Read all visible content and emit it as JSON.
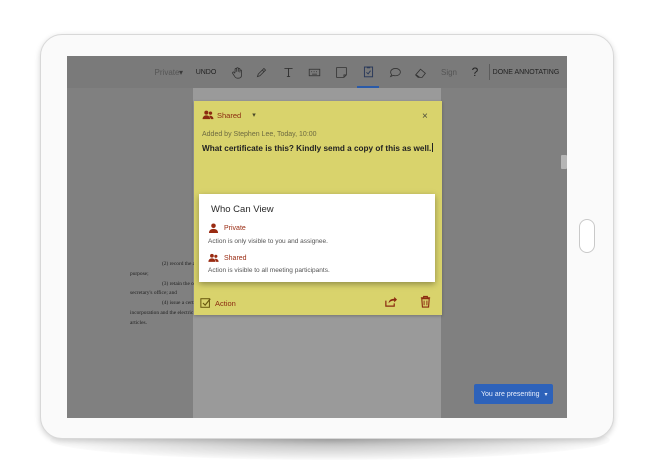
{
  "toolbar": {
    "privacy_label": "Private",
    "undo_label": "UNDO",
    "sign_label": "Sign",
    "help_label": "?",
    "done_label": "DONE ANNOTATING",
    "tools": [
      "hand-icon",
      "highlighter-icon",
      "text-icon",
      "keyboard-icon",
      "note-icon",
      "action-icon",
      "comment-icon",
      "eraser-icon"
    ],
    "active_tool": "action-icon"
  },
  "note": {
    "visibility_label": "Shared",
    "meta": "Added by Stephen Lee, Today, 10:00",
    "body": "What certificate is this? Kindly semd a copy of this as well.",
    "close_label": "×",
    "action_label": "Action"
  },
  "popup": {
    "title": "Who Can View",
    "options": [
      {
        "label": "Private",
        "description": "Action is only visible to you and assignee."
      },
      {
        "label": "Shared",
        "description": "Action is visible to all meeting participants."
      }
    ]
  },
  "document": {
    "lines": [
      "(2)  record the articles at length in a book to be kept for that",
      "purpose;",
      "(3)  retain the original articles of incorporation on file in the",
      "secretary's office; and",
      "(4)  issue a certificate showing the recording of the articles of",
      "incorporation and the electric cooperative's authority to do business under the",
      "articles."
    ]
  },
  "presenting": {
    "label": "You are presenting"
  },
  "colors": {
    "note_bg": "#d9d36c",
    "accent_red": "#9a2b12",
    "present_blue": "#2d62ba",
    "active_tool": "#2a5aa8"
  }
}
